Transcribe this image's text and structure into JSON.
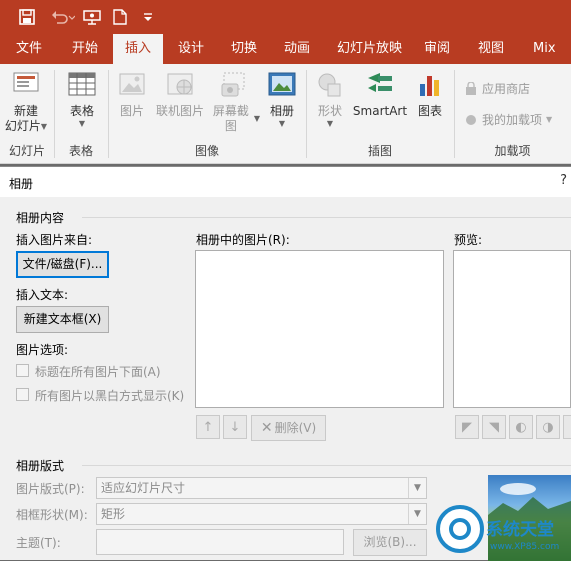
{
  "tabs": [
    "文件",
    "开始",
    "插入",
    "设计",
    "切换",
    "动画",
    "幻灯片放映",
    "审阅",
    "视图",
    "Mix"
  ],
  "ribbon": {
    "new_slide": "新建",
    "new_slide_2": "幻灯片",
    "table": "表格",
    "pictures": "图片",
    "online_pictures": "联机图片",
    "screenshot": "屏幕截图",
    "photo_album": "相册",
    "shapes": "形状",
    "smartart": "SmartArt",
    "chart": "图表",
    "store": "应用商店",
    "my_addins": "我的加载项",
    "groups": {
      "slides": "幻灯片",
      "tables": "表格",
      "images": "图像",
      "illustrations": "插图",
      "addins": "加载项"
    }
  },
  "dialog": {
    "title": "相册",
    "help": "?",
    "album_content": "相册内容",
    "insert_from": "插入图片来自:",
    "file_disk_btn": "文件/磁盘(F)...",
    "insert_text": "插入文本:",
    "new_textbox_btn": "新建文本框(X)",
    "picture_options": "图片选项:",
    "captions_below": "标题在所有图片下面(A)",
    "all_black_white": "所有图片以黑白方式显示(K)",
    "pictures_in_album": "相册中的图片(R):",
    "preview": "预览:",
    "remove_btn": "删除(V)",
    "album_layout": "相册版式",
    "picture_layout_label": "图片版式(P):",
    "picture_layout_value": "适应幻灯片尺寸",
    "frame_shape_label": "相框形状(M):",
    "frame_shape_value": "矩形",
    "theme_label": "主题(T):",
    "browse_btn": "浏览(B)...",
    "watermark": "系统天堂",
    "watermark_url": "www.XP85.com"
  },
  "colors": {
    "accent": "#b83c22",
    "dialog_bg": "#f0f0f0",
    "focus": "#0078d7"
  }
}
